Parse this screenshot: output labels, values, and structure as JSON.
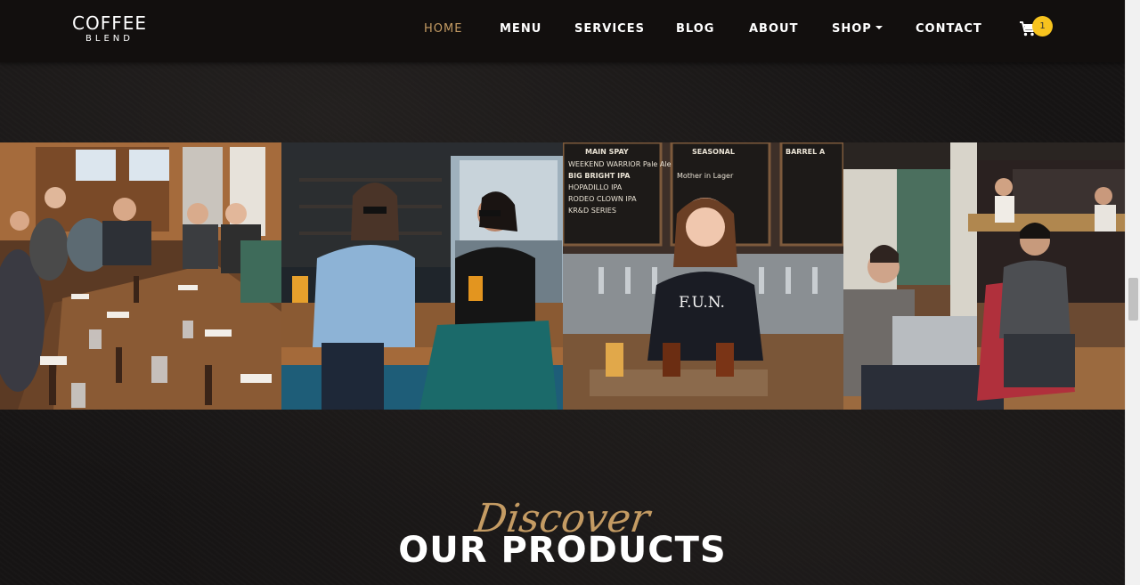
{
  "brand": {
    "line1": "COFFEE",
    "line2": "BLEND"
  },
  "nav": {
    "items": [
      {
        "label": "HOME",
        "active": true
      },
      {
        "label": "MENU",
        "active": false
      },
      {
        "label": "SERVICES",
        "active": false
      },
      {
        "label": "BLOG",
        "active": false
      },
      {
        "label": "ABOUT",
        "active": false
      },
      {
        "label": "SHOP",
        "active": false,
        "dropdown": true
      },
      {
        "label": "CONTACT",
        "active": false
      }
    ],
    "cart_icon": "cart-icon",
    "cart_count": "1"
  },
  "gallery": {
    "images": [
      {
        "name": "group-dinner-photo",
        "menu_board": []
      },
      {
        "name": "friends-laughing-photo",
        "menu_board": []
      },
      {
        "name": "bartender-tasting-photo",
        "shirt_text": "F.U.N.",
        "menu_board": [
          "MAIN SPAY",
          "WEEKEND WARRIOR Pale Ale",
          "BIG BRIGHT IPA",
          "HOPADILLO IPA",
          "RODEO CLOWN IPA",
          "KR&D SERIES",
          "SEASONAL",
          "Mother in Lager",
          "BARREL A"
        ]
      },
      {
        "name": "cafe-lounge-photo",
        "menu_board": []
      }
    ]
  },
  "heading": {
    "script": "Discover",
    "title": "OUR PRODUCTS"
  },
  "colors": {
    "accent": "#c49b63",
    "badge": "#f7c31e",
    "nav_bg": "#120f0e"
  }
}
